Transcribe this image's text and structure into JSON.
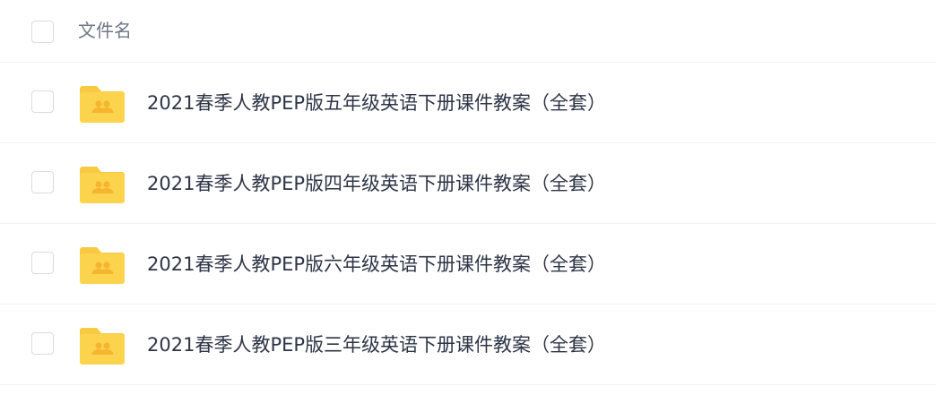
{
  "header": {
    "column_label": "文件名"
  },
  "files": [
    {
      "name": "2021春季人教PEP版五年级英语下册课件教案（全套）",
      "icon": "shared-folder-icon"
    },
    {
      "name": "2021春季人教PEP版四年级英语下册课件教案（全套）",
      "icon": "shared-folder-icon"
    },
    {
      "name": "2021春季人教PEP版六年级英语下册课件教案（全套）",
      "icon": "shared-folder-icon"
    },
    {
      "name": "2021春季人教PEP版三年级英语下册课件教案（全套）",
      "icon": "shared-folder-icon"
    }
  ],
  "colors": {
    "folder": "#fcd34d",
    "folder_tab": "#f8c943",
    "folder_glyph": "#f5b52f",
    "divider": "#f0f0f2",
    "text": "#2e3547",
    "header_text": "#6f7785"
  }
}
